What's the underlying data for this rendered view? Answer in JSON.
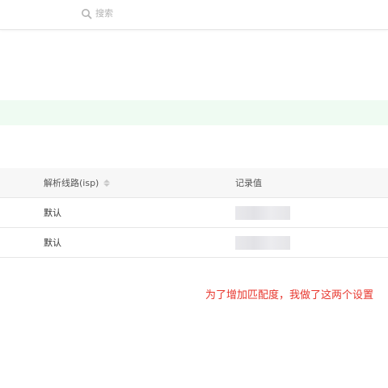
{
  "search": {
    "label": "搜索",
    "icon": "search-icon"
  },
  "table": {
    "columns": [
      {
        "label": "解析线路(isp)",
        "sortable": true
      },
      {
        "label": "记录值",
        "sortable": false
      }
    ],
    "rows": [
      {
        "line": "默认",
        "value_masked": true
      },
      {
        "line": "默认",
        "value_masked": true
      }
    ]
  },
  "annotation": {
    "text": "为了增加匹配度，我做了这两个设置",
    "color": "#e8362d"
  },
  "colors": {
    "notice_band": "#effbf2",
    "header_bg": "#f7f7f7"
  }
}
